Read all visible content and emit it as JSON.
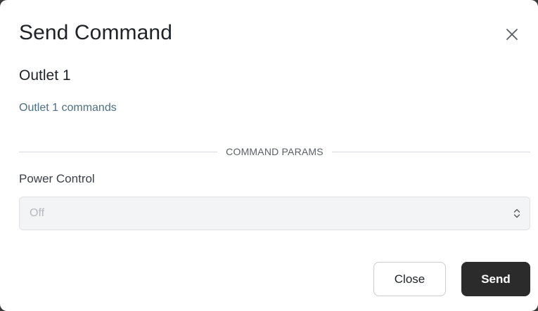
{
  "dialog": {
    "title": "Send Command",
    "subtitle": "Outlet 1",
    "description": "Outlet 1 commands",
    "section_label": "COMMAND PARAMS",
    "field": {
      "label": "Power Control",
      "value": "Off"
    },
    "buttons": {
      "close_label": "Close",
      "send_label": "Send"
    }
  },
  "colors": {
    "send_button": "#2b2b2b",
    "description_text": "#4d6f84"
  },
  "icons": {
    "close": "close-icon",
    "select": "chevron-up-down-icon"
  }
}
